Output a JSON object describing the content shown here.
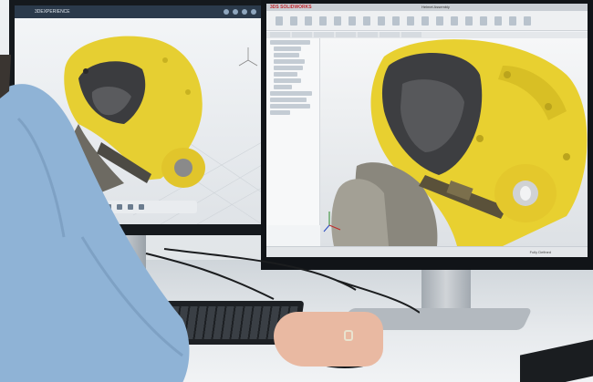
{
  "scene": {
    "caption": "",
    "left_screen": {
      "app_title": "3DEXPERIENCE",
      "icon_names": [
        "share-icon",
        "bell-icon",
        "help-icon",
        "user-icon"
      ],
      "tool_icon_names": [
        "home-icon",
        "pan-icon",
        "zoom-icon",
        "rotate-icon",
        "section-icon",
        "render-icon"
      ]
    },
    "right_screen": {
      "logo": "3DS SOLIDWORKS",
      "window_title": "Helmet Assembly",
      "status_text": "Fully Defined",
      "tree_rows": 14
    },
    "colors": {
      "helmet_yellow": "#e9d235",
      "helmet_dark": "#3b3c3f",
      "shirt_blue": "#8fb3d6",
      "skin": "#e9b9a2",
      "viewport_bg": "#eceef1"
    }
  }
}
